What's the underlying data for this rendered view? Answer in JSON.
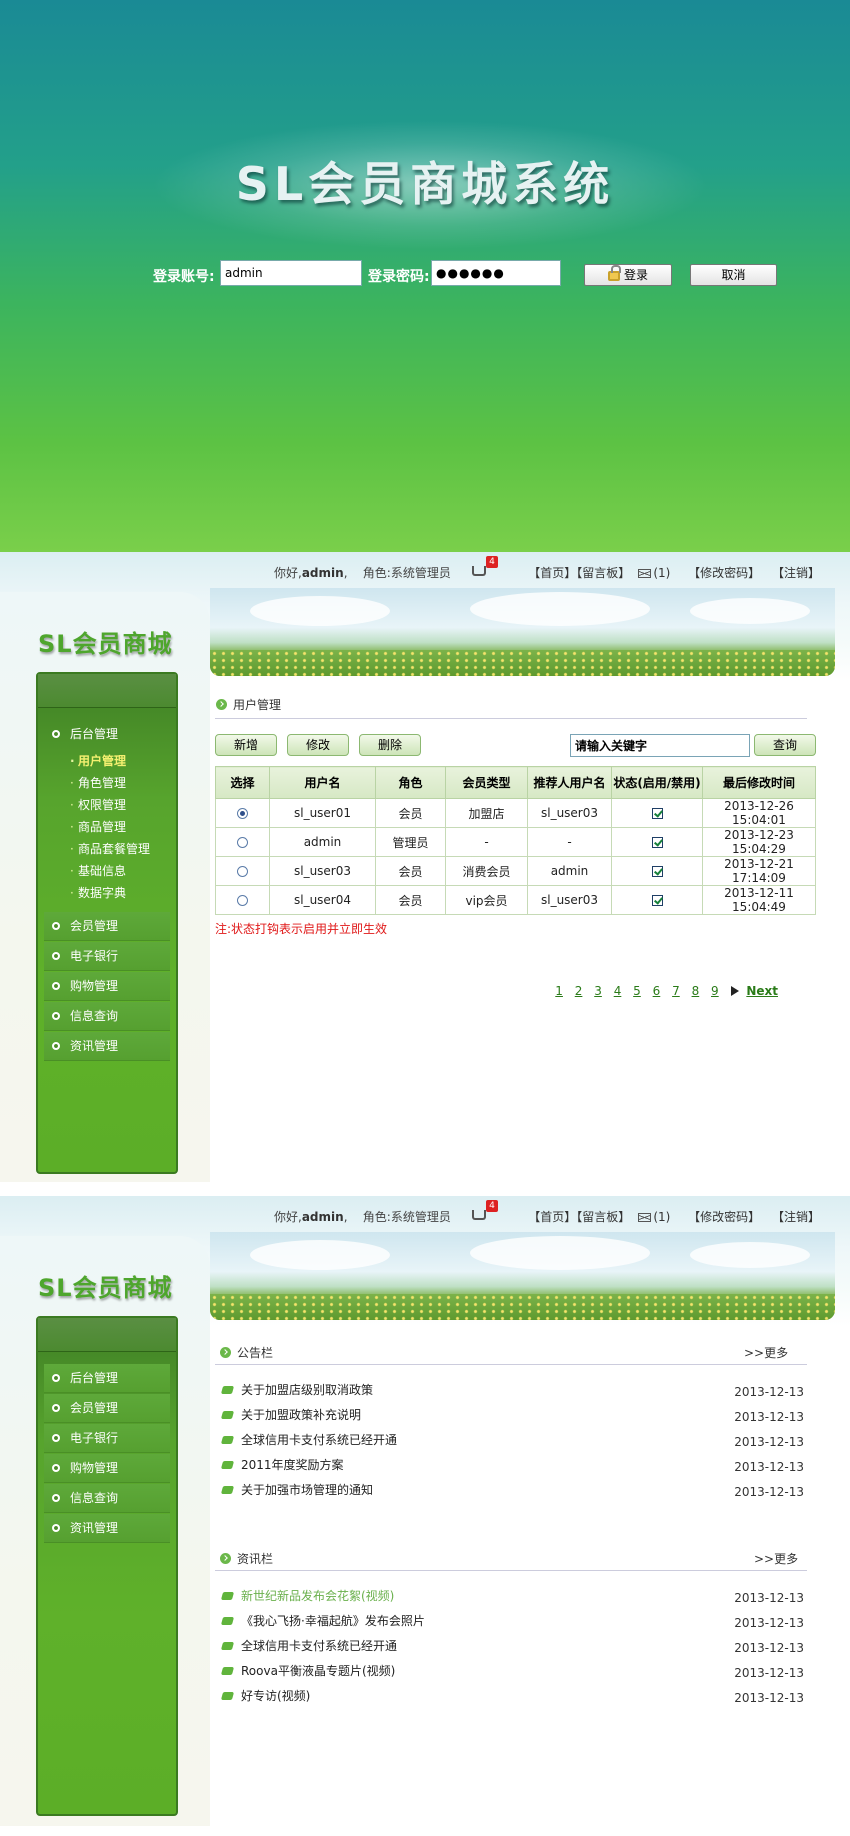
{
  "login": {
    "title": "SL会员商城系统",
    "account_label": "登录账号:",
    "account_value": "admin",
    "password_label": "登录密码:",
    "password_value": "●●●●●●",
    "login_button": "登录",
    "cancel_button": "取消"
  },
  "header": {
    "greeting": "你好,",
    "username": "admin",
    "role_label": "角色:",
    "role_value": "系统管理员",
    "cart_count": "4",
    "link_home": "【首页】",
    "link_board": "【留言板】",
    "mail_count": "(1)",
    "link_password": "【修改密码】",
    "link_logout": "【注销】"
  },
  "brand": "SL会员商城",
  "sidebar": {
    "items": [
      {
        "label": "后台管理"
      },
      {
        "label": "会员管理"
      },
      {
        "label": "电子银行"
      },
      {
        "label": "购物管理"
      },
      {
        "label": "信息查询"
      },
      {
        "label": "资讯管理"
      }
    ],
    "sub_items": [
      {
        "label": "用户管理"
      },
      {
        "label": "角色管理"
      },
      {
        "label": "权限管理"
      },
      {
        "label": "商品管理"
      },
      {
        "label": "商品套餐管理"
      },
      {
        "label": "基础信息"
      },
      {
        "label": "数据字典"
      }
    ]
  },
  "users_page": {
    "breadcrumb": "用户管理",
    "add_button": "新增",
    "edit_button": "修改",
    "delete_button": "删除",
    "search_value": "请输入关键字",
    "search_button": "查询",
    "columns": [
      "选择",
      "用户名",
      "角色",
      "会员类型",
      "推荐人用户名",
      "状态(启用/禁用)",
      "最后修改时间"
    ],
    "rows": [
      {
        "user": "sl_user01",
        "role": "会员",
        "type": "加盟店",
        "ref": "sl_user03",
        "time": "2013-12-26 15:04:01"
      },
      {
        "user": "admin",
        "role": "管理员",
        "type": "-",
        "ref": "-",
        "time": "2013-12-23 15:04:29"
      },
      {
        "user": "sl_user03",
        "role": "会员",
        "type": "消费会员",
        "ref": "admin",
        "time": "2013-12-21 17:14:09"
      },
      {
        "user": "sl_user04",
        "role": "会员",
        "type": "vip会员",
        "ref": "sl_user03",
        "time": "2013-12-11 15:04:49"
      }
    ],
    "note": "注:状态打钩表示启用并立即生效",
    "pages": [
      "1",
      "2",
      "3",
      "4",
      "5",
      "6",
      "7",
      "8",
      "9"
    ],
    "next": "Next"
  },
  "home_page": {
    "notice_title": "公告栏",
    "notice_more": ">>更多",
    "notices": [
      {
        "title": "关于加盟店级别取消政策",
        "date": "2013-12-13"
      },
      {
        "title": "关于加盟政策补充说明",
        "date": "2013-12-13"
      },
      {
        "title": "全球信用卡支付系统已经开通",
        "date": "2013-12-13"
      },
      {
        "title": "2011年度奖励方案",
        "date": "2013-12-13"
      },
      {
        "title": "关于加强市场管理的通知",
        "date": "2013-12-13"
      }
    ],
    "news_title": "资讯栏",
    "news_more": ">>更多",
    "news": [
      {
        "title": "新世纪新品发布会花絮(视频)",
        "date": "2013-12-13"
      },
      {
        "title": "《我心飞扬·幸福起航》发布会照片",
        "date": "2013-12-13"
      },
      {
        "title": "全球信用卡支付系统已经开通",
        "date": "2013-12-13"
      },
      {
        "title": "Roova平衡液晶专题片(视频)",
        "date": "2013-12-13"
      },
      {
        "title": "好专访(视频)",
        "date": "2013-12-13"
      }
    ]
  }
}
